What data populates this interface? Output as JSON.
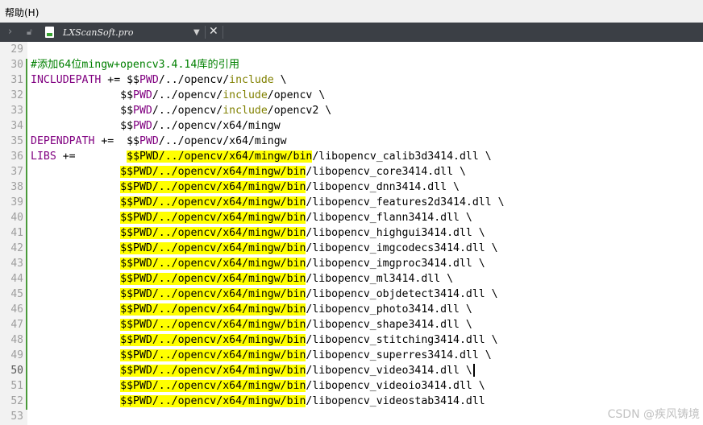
{
  "menubar": {
    "help_label": "帮助(H)"
  },
  "tab": {
    "title": "LXScanSoft.pro"
  },
  "colors": {
    "keyword": "#800080",
    "comment": "#008000",
    "directive": "#808000",
    "highlight": "#ffff00"
  },
  "editor": {
    "current_line": 50,
    "lines": [
      {
        "n": 29,
        "tokens": []
      },
      {
        "n": 30,
        "tokens": [
          {
            "t": "#添加64位mingw+opencv3.4.14库的引用",
            "c": "cm"
          }
        ]
      },
      {
        "n": 31,
        "tokens": [
          {
            "t": "INCLUDEPATH",
            "c": "kw"
          },
          {
            "t": " += $$"
          },
          {
            "t": "PWD",
            "c": "kw"
          },
          {
            "t": "/../opencv/"
          },
          {
            "t": "include",
            "c": "dir"
          },
          {
            "t": " \\"
          }
        ]
      },
      {
        "n": 32,
        "tokens": [
          {
            "t": "              $$"
          },
          {
            "t": "PWD",
            "c": "kw"
          },
          {
            "t": "/../opencv/"
          },
          {
            "t": "include",
            "c": "dir"
          },
          {
            "t": "/opencv \\"
          }
        ]
      },
      {
        "n": 33,
        "tokens": [
          {
            "t": "              $$"
          },
          {
            "t": "PWD",
            "c": "kw"
          },
          {
            "t": "/../opencv/"
          },
          {
            "t": "include",
            "c": "dir"
          },
          {
            "t": "/opencv2 \\"
          }
        ]
      },
      {
        "n": 34,
        "tokens": [
          {
            "t": "              $$"
          },
          {
            "t": "PWD",
            "c": "kw"
          },
          {
            "t": "/../opencv/x64/mingw"
          }
        ]
      },
      {
        "n": 35,
        "tokens": [
          {
            "t": "DEPENDPATH",
            "c": "kw"
          },
          {
            "t": " +=  $$"
          },
          {
            "t": "PWD",
            "c": "kw"
          },
          {
            "t": "/../opencv/x64/mingw"
          }
        ]
      },
      {
        "n": 36,
        "tokens": [
          {
            "t": "LIBS",
            "c": "kw"
          },
          {
            "t": " +=        "
          },
          {
            "t": "$$PWD/../opencv/x64/mingw/bin",
            "c": "hl"
          },
          {
            "t": "/libopencv_calib3d3414.dll \\"
          }
        ]
      },
      {
        "n": 37,
        "tokens": [
          {
            "t": "              "
          },
          {
            "t": "$$PWD/../opencv/x64/mingw/bin",
            "c": "hl"
          },
          {
            "t": "/libopencv_core3414.dll \\"
          }
        ]
      },
      {
        "n": 38,
        "tokens": [
          {
            "t": "              "
          },
          {
            "t": "$$PWD/../opencv/x64/mingw/bin",
            "c": "hl"
          },
          {
            "t": "/libopencv_dnn3414.dll \\"
          }
        ]
      },
      {
        "n": 39,
        "tokens": [
          {
            "t": "              "
          },
          {
            "t": "$$PWD/../opencv/x64/mingw/bin",
            "c": "hl"
          },
          {
            "t": "/libopencv_features2d3414.dll \\"
          }
        ]
      },
      {
        "n": 40,
        "tokens": [
          {
            "t": "              "
          },
          {
            "t": "$$PWD/../opencv/x64/mingw/bin",
            "c": "hl"
          },
          {
            "t": "/libopencv_flann3414.dll \\"
          }
        ]
      },
      {
        "n": 41,
        "tokens": [
          {
            "t": "              "
          },
          {
            "t": "$$PWD/../opencv/x64/mingw/bin",
            "c": "hl"
          },
          {
            "t": "/libopencv_highgui3414.dll \\"
          }
        ]
      },
      {
        "n": 42,
        "tokens": [
          {
            "t": "              "
          },
          {
            "t": "$$PWD/../opencv/x64/mingw/bin",
            "c": "hl"
          },
          {
            "t": "/libopencv_imgcodecs3414.dll \\"
          }
        ]
      },
      {
        "n": 43,
        "tokens": [
          {
            "t": "              "
          },
          {
            "t": "$$PWD/../opencv/x64/mingw/bin",
            "c": "hl"
          },
          {
            "t": "/libopencv_imgproc3414.dll \\"
          }
        ]
      },
      {
        "n": 44,
        "tokens": [
          {
            "t": "              "
          },
          {
            "t": "$$PWD/../opencv/x64/mingw/bin",
            "c": "hl"
          },
          {
            "t": "/libopencv_ml3414.dll \\"
          }
        ]
      },
      {
        "n": 45,
        "tokens": [
          {
            "t": "              "
          },
          {
            "t": "$$PWD/../opencv/x64/mingw/bin",
            "c": "hl"
          },
          {
            "t": "/libopencv_objdetect3414.dll \\"
          }
        ]
      },
      {
        "n": 46,
        "tokens": [
          {
            "t": "              "
          },
          {
            "t": "$$PWD/../opencv/x64/mingw/bin",
            "c": "hl"
          },
          {
            "t": "/libopencv_photo3414.dll \\"
          }
        ]
      },
      {
        "n": 47,
        "tokens": [
          {
            "t": "              "
          },
          {
            "t": "$$PWD/../opencv/x64/mingw/bin",
            "c": "hl"
          },
          {
            "t": "/libopencv_shape3414.dll \\"
          }
        ]
      },
      {
        "n": 48,
        "tokens": [
          {
            "t": "              "
          },
          {
            "t": "$$PWD/../opencv/x64/mingw/bin",
            "c": "hl"
          },
          {
            "t": "/libopencv_stitching3414.dll \\"
          }
        ]
      },
      {
        "n": 49,
        "tokens": [
          {
            "t": "              "
          },
          {
            "t": "$$PWD/../opencv/x64/mingw/bin",
            "c": "hl"
          },
          {
            "t": "/libopencv_superres3414.dll \\"
          }
        ]
      },
      {
        "n": 50,
        "tokens": [
          {
            "t": "              "
          },
          {
            "t": "$$PWD/../opencv/x64/mingw/bin",
            "c": "hl"
          },
          {
            "t": "/libopencv_video3414.dll \\"
          }
        ],
        "caret": true
      },
      {
        "n": 51,
        "tokens": [
          {
            "t": "              "
          },
          {
            "t": "$$PWD/../opencv/x64/mingw/bin",
            "c": "hl"
          },
          {
            "t": "/libopencv_videoio3414.dll \\"
          }
        ]
      },
      {
        "n": 52,
        "tokens": [
          {
            "t": "              "
          },
          {
            "t": "$$PWD/../opencv/x64/mingw/bin",
            "c": "hl"
          },
          {
            "t": "/libopencv_videostab3414.dll"
          }
        ]
      },
      {
        "n": 53,
        "tokens": []
      }
    ]
  },
  "watermark": "CSDN @疾风铸境"
}
